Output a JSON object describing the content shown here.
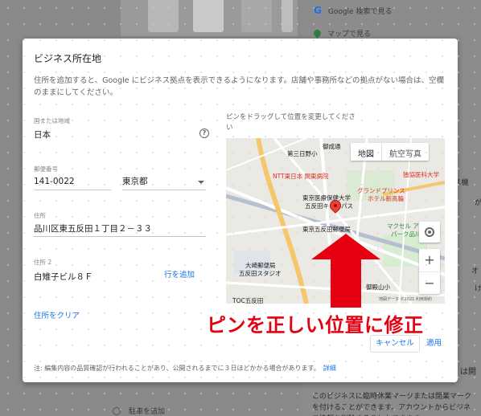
{
  "background": {
    "right_rows": [
      {
        "icon": "google-logo",
        "text": "Google 検索で見る"
      },
      {
        "icon": "map-pin",
        "text": "マップで見る"
      }
    ],
    "right_fragments": [
      "ース機",
      "が",
      "オ",
      "け",
      "は開"
    ],
    "bottom_text": "このビジネスに臨時休業マークまたは閉業マークを付けることができます。アカウントからビジネス情報を削除することもできます",
    "bottom_left_label": "駐車を追加"
  },
  "dialog": {
    "title": "ビジネス所在地",
    "description": "住所を追加すると、Google にビジネス拠点を表示できるようになります。店舗や事務所などの拠点がない場合は、空欄のままにしてください。",
    "country": {
      "label": "国または地域",
      "value": "日本"
    },
    "postal": {
      "label": "郵便番号",
      "value": "141-0022"
    },
    "prefecture": {
      "value": "東京都"
    },
    "address1": {
      "label": "住所",
      "value": "品川区東五反田１丁目２－３３"
    },
    "address2": {
      "label": "住所 2",
      "value": "白雉子ビル８Ｆ"
    },
    "add_line_link": "行を追加",
    "clear_address_link": "住所をクリア",
    "map_hint": "ピンをドラッグして位置を変更してください",
    "map_type": {
      "map": "地図",
      "satellite": "航空写真"
    },
    "map_copyright": "地図データ ©2021 利用規約",
    "footer_note": "注: 編集内容の品質確認が行われることがあり、公開されるまでに３日ほどかかる場合があります。",
    "footer_link": "詳細",
    "cancel_label": "キャンセル",
    "apply_label": "適用"
  },
  "map_labels": [
    {
      "text": "第三日野小",
      "color": "#5f6368"
    },
    {
      "text": "御成通",
      "color": "#5f6368"
    },
    {
      "text": "NTT東日本 関東病院",
      "color": "#d93025"
    },
    {
      "text": "東京医療保健大学",
      "color": "#5f6368"
    },
    {
      "text": "五反田キャンパス",
      "color": "#5f6368"
    },
    {
      "text": "グランドプリンス",
      "color": "#d93025"
    },
    {
      "text": "ホテル新高輪",
      "color": "#d93025"
    },
    {
      "text": "独協医科大学",
      "color": "#d93025"
    },
    {
      "text": "東京五反田郵便局",
      "color": "#5f6368"
    },
    {
      "text": "マクセル アクア",
      "color": "#1e8e3e"
    },
    {
      "text": "パーク品川",
      "color": "#1e8e3e"
    },
    {
      "text": "大崎郵便局",
      "color": "#5f6368"
    },
    {
      "text": "五反田スタジオ",
      "color": "#5f6368"
    },
    {
      "text": "TOC五反田",
      "color": "#5f6368"
    },
    {
      "text": "御殿山小",
      "color": "#5f6368"
    }
  ],
  "annotation": {
    "text": "ピンを正しい位置に修正",
    "color": "#e60012"
  }
}
